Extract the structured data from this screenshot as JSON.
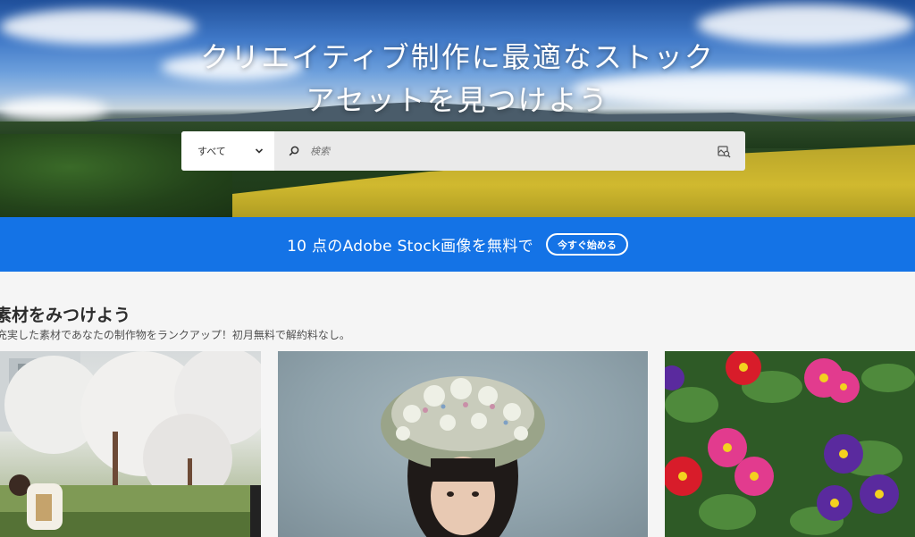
{
  "hero": {
    "title_line1": "クリエイティブ制作に最適なストック",
    "title_line2": "アセットを見つけよう"
  },
  "search": {
    "category": "すべて",
    "placeholder": "検索"
  },
  "banner": {
    "text": "10 点のAdobe Stock画像を無料で",
    "cta": "今すぐ始める",
    "color": "#1473e6"
  },
  "section": {
    "title": "素材をみつけよう",
    "subtitle": "充実した素材であなたの制作物をランクアップ！初月無料で解約料なし。"
  },
  "icons": {
    "dropdown": "chevron-down-icon",
    "search": "search-icon",
    "visual_search": "visual-search-icon"
  }
}
